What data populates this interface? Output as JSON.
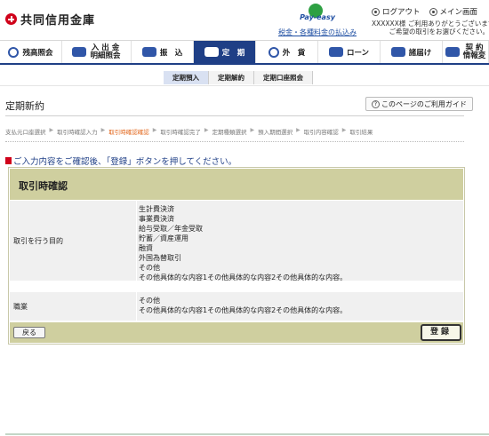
{
  "header": {
    "bank_name": "共同信用金庫",
    "payeasy_word": "Pay-easy",
    "payeasy_link": "税金・各種料金の払込み",
    "logout": "ログアウト",
    "main_screen": "メイン画面",
    "welcome_line1": "XXXXXX様 ご利用ありがとうございます。",
    "welcome_line2": "ご希望の取引をお選びください。"
  },
  "main_nav": [
    {
      "label": "残高照会",
      "icon": "balance-icon"
    },
    {
      "label": "入 出 金\n明細照会",
      "icon": "transfer-arrows-icon"
    },
    {
      "label": "振　込",
      "icon": "money-icon"
    },
    {
      "label": "定　期",
      "icon": "deposit-icon",
      "active": true
    },
    {
      "label": "外　貨",
      "icon": "dollar-icon"
    },
    {
      "label": "ローン",
      "icon": "loan-icon"
    },
    {
      "label": "諸届け",
      "icon": "notice-icon"
    },
    {
      "label": "契 約\n情報変",
      "icon": "contract-icon"
    }
  ],
  "sub_nav": [
    "定期預入",
    "定期解約",
    "定期口座照会"
  ],
  "page": {
    "title": "定期新約",
    "guide_button": "このページのご利用ガイド"
  },
  "steps": [
    "支払元口座選択",
    "取引時確認入力",
    "取引時確認確認",
    "取引時確認完了",
    "定期種類選択",
    "預入期間選択",
    "取引内容確認",
    "取引結果"
  ],
  "current_step_index": 2,
  "instruction": "ご入力内容をご確認後、「登録」ボタンを押してください。",
  "confirm": {
    "title": "取引時確認",
    "purpose_label": "取引を行う目的",
    "purpose_values": [
      "生計費決済",
      "事業費決済",
      "給与受取／年金受取",
      "貯蓄／資産運用",
      "融資",
      "外国為替取引",
      "その他",
      "その他具体的な内容1その他具体的な内容2その他具体的な内容。"
    ],
    "occupation_label": "職業",
    "occupation_values": [
      "その他",
      "その他具体的な内容1その他具体的な内容2その他具体的な内容。"
    ],
    "back_button": "戻る",
    "register_button": "登録"
  },
  "colors": {
    "nav_active": "#1f3f86",
    "panel_header": "#cfcf9f",
    "current_step": "#e2651a",
    "brand_red": "#d0021b"
  }
}
